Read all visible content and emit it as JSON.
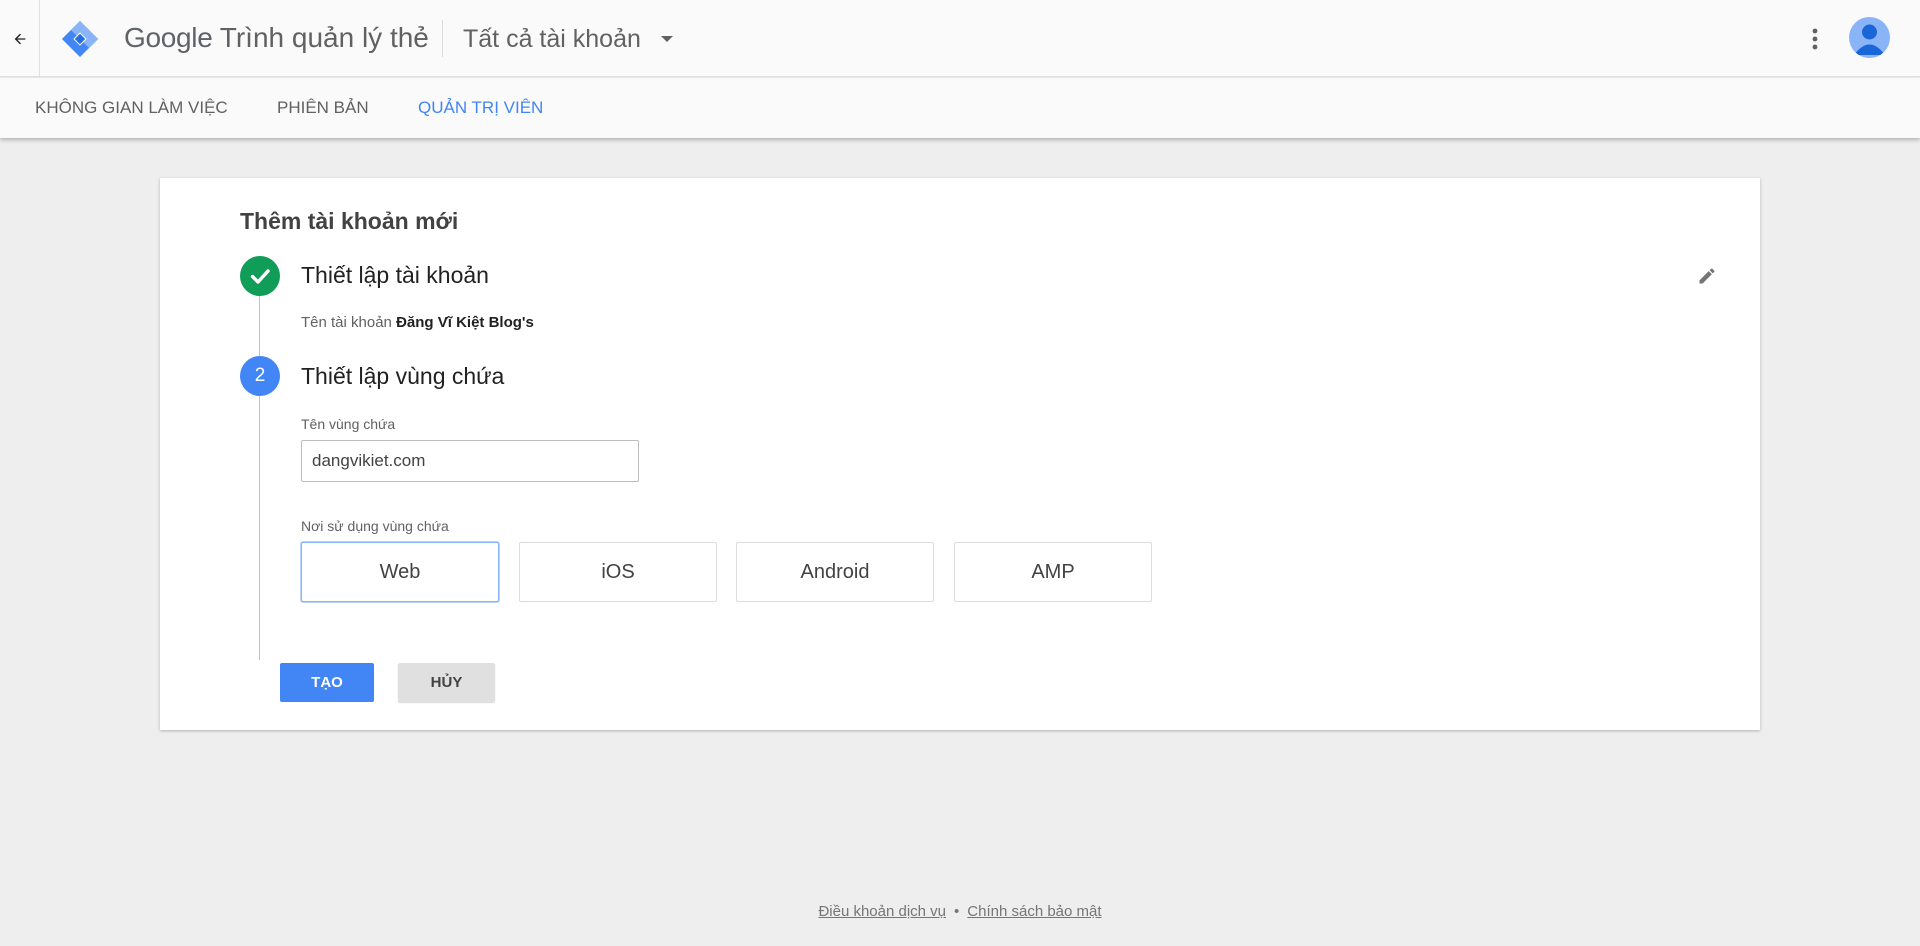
{
  "header": {
    "brand_google": "Google",
    "brand_product": "Trình quản lý thẻ",
    "account_picker_label": "Tất cả tài khoản"
  },
  "tabs": [
    {
      "label": "KHÔNG GIAN LÀM VIỆC",
      "active": false
    },
    {
      "label": "PHIÊN BẢN",
      "active": false
    },
    {
      "label": "QUẢN TRỊ VIÊN",
      "active": true
    }
  ],
  "card": {
    "title": "Thêm tài khoản mới",
    "step1": {
      "title": "Thiết lập tài khoản",
      "summary_label": "Tên tài khoản",
      "summary_value": "Đăng Vĩ Kiệt Blog's"
    },
    "step2": {
      "number": "2",
      "title": "Thiết lập vùng chứa",
      "container_name_label": "Tên vùng chứa",
      "container_name_value": "dangvikiet.com",
      "target_platform_label": "Nơi sử dụng vùng chứa",
      "platforms": [
        "Web",
        "iOS",
        "Android",
        "AMP"
      ],
      "selected_platform": "Web"
    },
    "create_label": "TẠO",
    "cancel_label": "HỦY"
  },
  "footer": {
    "terms": "Điều khoản dịch vụ",
    "separator": "•",
    "privacy": "Chính sách bảo mật"
  },
  "colors": {
    "accent": "#4285f4",
    "done": "#0f9d58",
    "background": "#eeeeee"
  }
}
